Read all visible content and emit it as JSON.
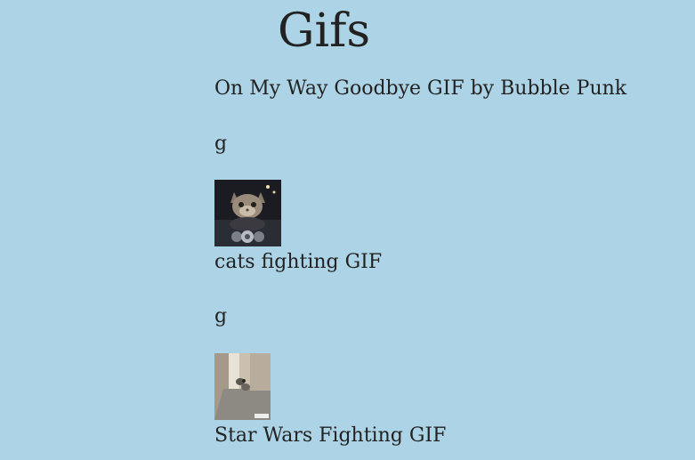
{
  "page": {
    "title": "Gifs",
    "background": "#add4e6",
    "text_color": "#222222"
  },
  "gifs": [
    {
      "title": "On My Way Goodbye GIF by Bubble Punk",
      "rating": "g",
      "thumbnail": "kitten-on-motorcycle"
    },
    {
      "title": "cats fighting GIF",
      "rating": "g",
      "thumbnail": "cat-in-hallway"
    },
    {
      "title": "Star Wars Fighting GIF"
    }
  ]
}
